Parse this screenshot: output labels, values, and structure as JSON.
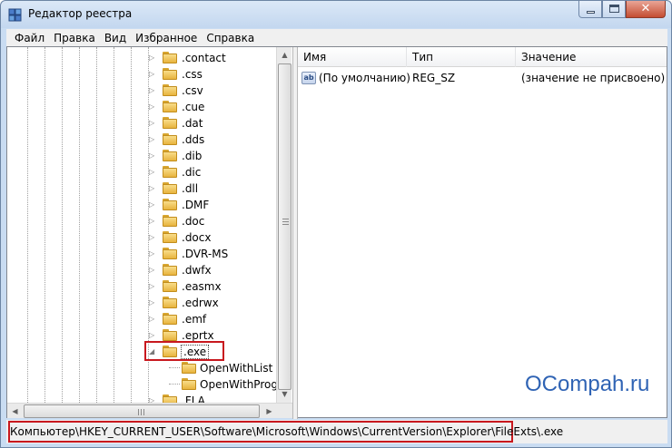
{
  "window": {
    "title": "Редактор реестра",
    "icon": "regedit-icon"
  },
  "menu": [
    {
      "label": "Файл"
    },
    {
      "label": "Правка"
    },
    {
      "label": "Вид"
    },
    {
      "label": "Избранное"
    },
    {
      "label": "Справка"
    }
  ],
  "tree": {
    "items": [
      {
        "label": ".contact",
        "expanded": false
      },
      {
        "label": ".css",
        "expanded": false
      },
      {
        "label": ".csv",
        "expanded": false
      },
      {
        "label": ".cue",
        "expanded": false
      },
      {
        "label": ".dat",
        "expanded": false
      },
      {
        "label": ".dds",
        "expanded": false
      },
      {
        "label": ".dib",
        "expanded": false
      },
      {
        "label": ".dic",
        "expanded": false
      },
      {
        "label": ".dll",
        "expanded": false
      },
      {
        "label": ".DMF",
        "expanded": false
      },
      {
        "label": ".doc",
        "expanded": false
      },
      {
        "label": ".docx",
        "expanded": false
      },
      {
        "label": ".DVR-MS",
        "expanded": false
      },
      {
        "label": ".dwfx",
        "expanded": false
      },
      {
        "label": ".easmx",
        "expanded": false
      },
      {
        "label": ".edrwx",
        "expanded": false
      },
      {
        "label": ".emf",
        "expanded": false
      },
      {
        "label": ".eprtx",
        "expanded": false
      },
      {
        "label": ".exe",
        "expanded": true,
        "selected": true
      },
      {
        "label": "OpenWithList",
        "child": true
      },
      {
        "label": "OpenWithProgid",
        "child": true
      },
      {
        "label": ".FLA",
        "expanded": false
      }
    ]
  },
  "list": {
    "columns": [
      "Имя",
      "Тип",
      "Значение"
    ],
    "rows": [
      {
        "icon": "ab",
        "name": "(По умолчанию)",
        "type": "REG_SZ",
        "value": "(значение не присвоено)"
      }
    ]
  },
  "watermark": "OCompah.ru",
  "status": {
    "path": "Компьютер\\HKEY_CURRENT_USER\\Software\\Microsoft\\Windows\\CurrentVersion\\Explorer\\FileExts\\.exe"
  },
  "colors": {
    "highlight_border": "#c8181e",
    "watermark": "#2f63b4"
  }
}
